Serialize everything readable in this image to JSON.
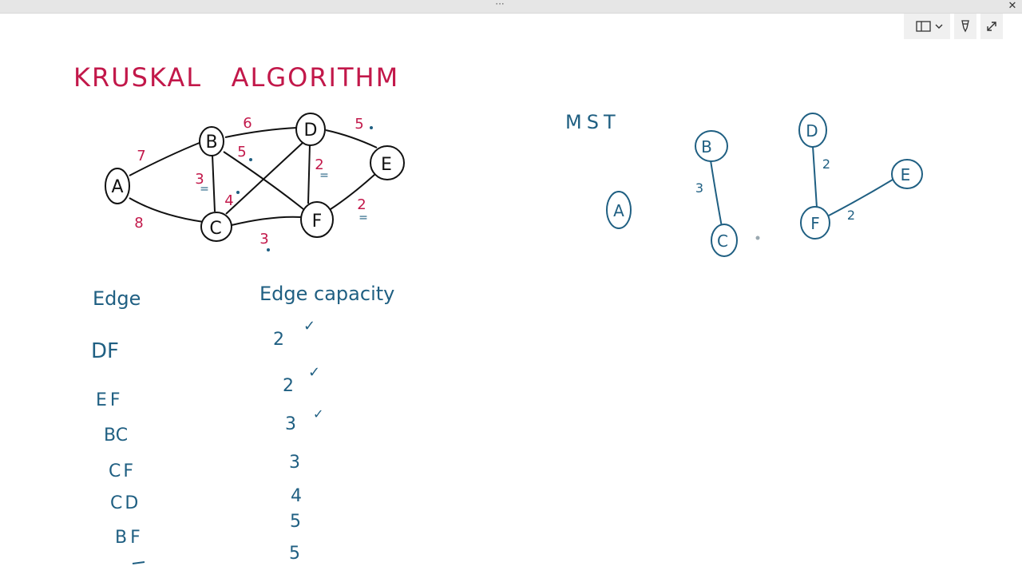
{
  "window": {
    "grip_label": "···",
    "close_icon_glyph": "✕"
  },
  "toolbar": {
    "view_icon": "panel-view-icon",
    "chevron_icon": "chevron-down-icon",
    "pen_icon": "pen-icon",
    "expand_icon": "expand-icon"
  },
  "colors": {
    "ink_red": "#c2184a",
    "ink_blue": "#1f5f82",
    "ink_black": "#111111"
  },
  "note": {
    "title": "KRUSKAL   ALGORITHM",
    "graph": {
      "nodes": [
        "A",
        "B",
        "C",
        "D",
        "E",
        "F"
      ],
      "weights": [
        "7",
        "8",
        "6",
        "5",
        "3",
        "4",
        "2",
        "5",
        "2",
        "3"
      ],
      "marks": [
        "=",
        "=",
        "="
      ]
    },
    "mst": {
      "label": "MST",
      "nodes": [
        "A",
        "B",
        "C",
        "D",
        "E",
        "F"
      ],
      "weights": [
        "3",
        "2",
        "2"
      ]
    },
    "table": {
      "header_edge": "Edge",
      "header_capacity": "Edge capacity",
      "rows": [
        {
          "edge": "DF",
          "capacity": "2",
          "check": "✓"
        },
        {
          "edge": "EF",
          "capacity": "2",
          "check": "✓"
        },
        {
          "edge": "BC",
          "capacity": "3",
          "check": "✓"
        },
        {
          "edge": "CF",
          "capacity": "3",
          "check": ""
        },
        {
          "edge": "CD",
          "capacity": "4",
          "check": ""
        },
        {
          "edge": "BF",
          "capacity": "5",
          "check": ""
        },
        {
          "edge": "",
          "capacity": "5",
          "check": ""
        }
      ]
    }
  }
}
